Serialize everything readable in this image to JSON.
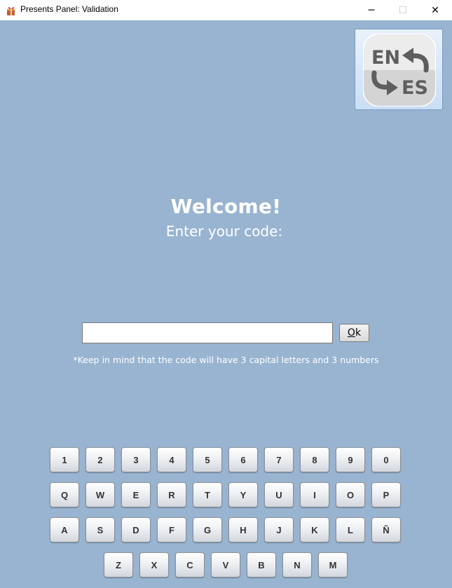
{
  "window": {
    "title": "Presents Panel: Validation",
    "minimize_glyph": "─",
    "maximize_glyph": "☐",
    "close_glyph": "✕"
  },
  "language_toggle": {
    "from": "EN",
    "to": "ES",
    "icon": "language-swap-icon"
  },
  "welcome": {
    "title": "Welcome!",
    "subtitle": "Enter your code:"
  },
  "code_form": {
    "input_value": "",
    "ok_mnemonic": "O",
    "ok_rest": "k",
    "hint": "*Keep in mind that the code will have 3 capital letters and 3 numbers"
  },
  "keyboard": {
    "row1": [
      "1",
      "2",
      "3",
      "4",
      "5",
      "6",
      "7",
      "8",
      "9",
      "0"
    ],
    "row2": [
      "Q",
      "W",
      "E",
      "R",
      "T",
      "Y",
      "U",
      "I",
      "O",
      "P"
    ],
    "row3": [
      "A",
      "S",
      "D",
      "F",
      "G",
      "H",
      "J",
      "K",
      "L",
      "Ñ"
    ],
    "row4": [
      "Z",
      "X",
      "C",
      "V",
      "B",
      "N",
      "M"
    ]
  },
  "colors": {
    "background": "#99b4d1",
    "text": "#ffffff"
  }
}
